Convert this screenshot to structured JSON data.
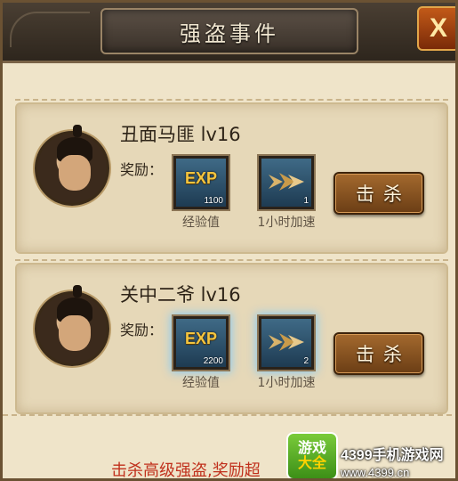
{
  "dialog": {
    "title": "强盗事件",
    "close_label": "X"
  },
  "bandits": [
    {
      "name": "丑面马匪  lv16",
      "reward_label": "奖励：",
      "rewards": [
        {
          "icon": "exp-icon",
          "badge": "EXP",
          "count": "1100",
          "caption": "经验值"
        },
        {
          "icon": "speedup-icon",
          "count": "1",
          "caption": "1小时加速"
        }
      ],
      "kill_label": "击杀"
    },
    {
      "name": "关中二爷  lv16",
      "reward_label": "奖励：",
      "rewards": [
        {
          "icon": "exp-icon",
          "badge": "EXP",
          "count": "2200",
          "caption": "经验值"
        },
        {
          "icon": "speedup-icon",
          "count": "2",
          "caption": "1小时加速"
        }
      ],
      "kill_label": "击杀"
    }
  ],
  "footer": {
    "notice": "击杀高级强盗,奖励超"
  },
  "watermark": {
    "badge_line1": "游戏",
    "badge_line2": "大全",
    "site_name": "4399手机游戏网",
    "site_url": "www.4399.cn"
  },
  "colors": {
    "panel_bg": "#efe4c9",
    "card_bg": "#e6d8b8",
    "button_brown": "#8a5222",
    "close_orange": "#c25a18",
    "exp_gold": "#f4c540",
    "footer_red": "#c0301c",
    "rare_glow": "#78c8ff"
  }
}
